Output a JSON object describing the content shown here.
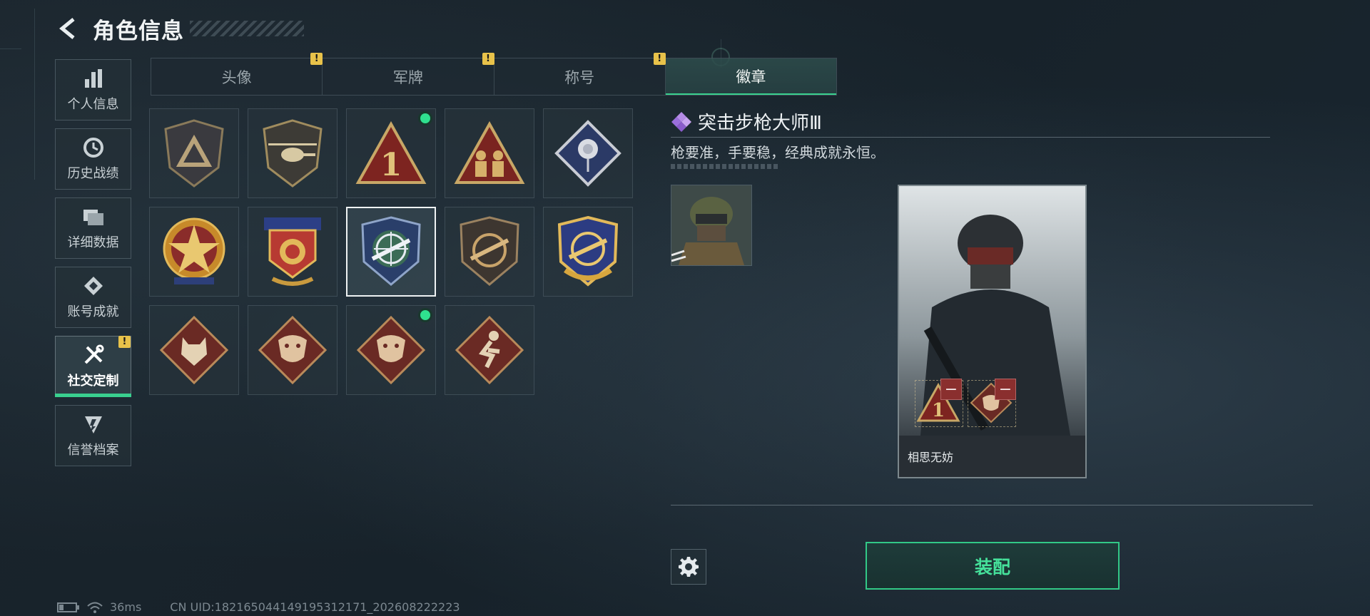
{
  "header": {
    "title": "角色信息"
  },
  "sidebar": {
    "items": [
      {
        "label": "个人信息",
        "icon": "bar-chart-icon",
        "active": false,
        "alert": false
      },
      {
        "label": "历史战绩",
        "icon": "clock-icon",
        "active": false,
        "alert": false
      },
      {
        "label": "详细数据",
        "icon": "folder-icon",
        "active": false,
        "alert": false
      },
      {
        "label": "账号成就",
        "icon": "achievement-icon",
        "active": false,
        "alert": false
      },
      {
        "label": "社交定制",
        "icon": "tools-icon",
        "active": true,
        "alert": true
      },
      {
        "label": "信誉档案",
        "icon": "shield-icon",
        "active": false,
        "alert": false
      }
    ],
    "alert_mark": "!"
  },
  "tabs": [
    {
      "label": "头像",
      "alert": true,
      "active": false
    },
    {
      "label": "军牌",
      "alert": true,
      "active": false
    },
    {
      "label": "称号",
      "alert": true,
      "active": false
    },
    {
      "label": "徽章",
      "alert": false,
      "active": true
    }
  ],
  "badges": [
    {
      "name": "tri-emblem-badge",
      "new": false,
      "selected": false
    },
    {
      "name": "helicopter-badge",
      "new": false,
      "selected": false
    },
    {
      "name": "number-one-badge",
      "new": true,
      "selected": false
    },
    {
      "name": "soldiers-badge",
      "new": false,
      "selected": false
    },
    {
      "name": "rose-badge",
      "new": false,
      "selected": false
    },
    {
      "name": "star-medal-badge",
      "new": false,
      "selected": false
    },
    {
      "name": "blue-star-crest-badge",
      "new": false,
      "selected": false
    },
    {
      "name": "assault-rifle-master-iii-badge",
      "new": false,
      "selected": true
    },
    {
      "name": "rifle-scope-bronze-badge",
      "new": false,
      "selected": false
    },
    {
      "name": "rifle-scope-gold-badge",
      "new": false,
      "selected": false
    },
    {
      "name": "wolf-badge",
      "new": false,
      "selected": false
    },
    {
      "name": "dragon-badge",
      "new": false,
      "selected": false
    },
    {
      "name": "dragon-badge-alt",
      "new": true,
      "selected": false
    },
    {
      "name": "runner-badge",
      "new": false,
      "selected": false
    }
  ],
  "detail": {
    "name": "突击步枪大师Ⅲ",
    "description": "枪要准，手要稳，经典成就永恒。",
    "card_player_name": "相思无妨",
    "slot_remove_mark": "−"
  },
  "actions": {
    "equip_label": "装配"
  },
  "status": {
    "ping": "36ms",
    "uid": "CN UID:18216504414919531​2171_202608222223"
  },
  "colors": {
    "accent": "#39d08f",
    "alert": "#e8c24a",
    "remove": "#8a2f2e"
  }
}
